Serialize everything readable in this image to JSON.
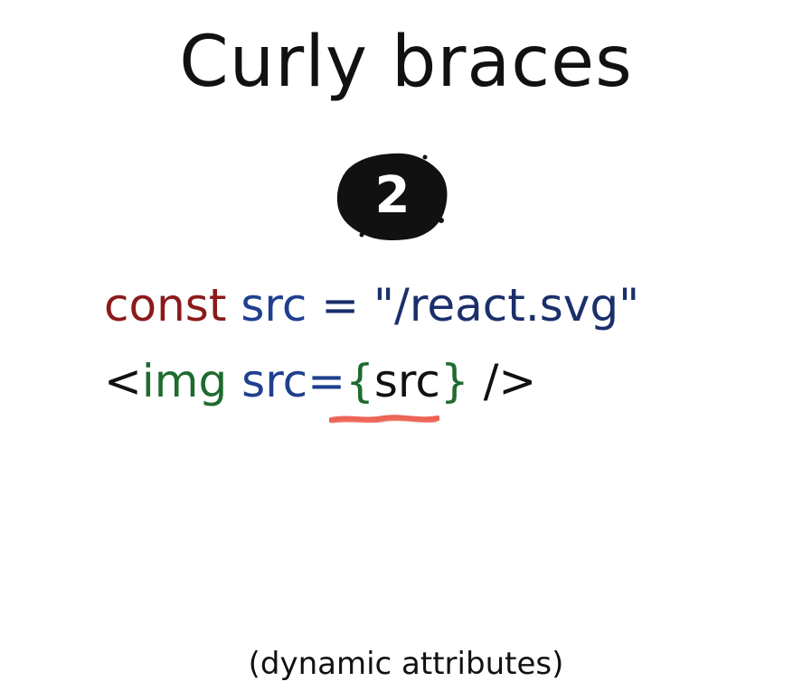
{
  "title": "Curly braces",
  "step_number": "2",
  "code": {
    "line1": {
      "keyword": "const",
      "space1": " ",
      "identifier": "src",
      "operator": " = ",
      "string": "\"/react.svg\""
    },
    "line2": {
      "open_bracket": "<",
      "tag": "img",
      "space": " ",
      "attr": "src=",
      "brace_open": "{",
      "expression": "src",
      "brace_close": "}",
      "close": " />"
    }
  },
  "caption": "(dynamic attributes)",
  "colors": {
    "keyword": "#8b1a1a",
    "identifier": "#1f3f8f",
    "string": "#1a2f6b",
    "tag": "#1f6b2f",
    "brace": "#1f6b2f",
    "plain": "#111111",
    "underline": "#e8493a",
    "badge": "#111111"
  }
}
